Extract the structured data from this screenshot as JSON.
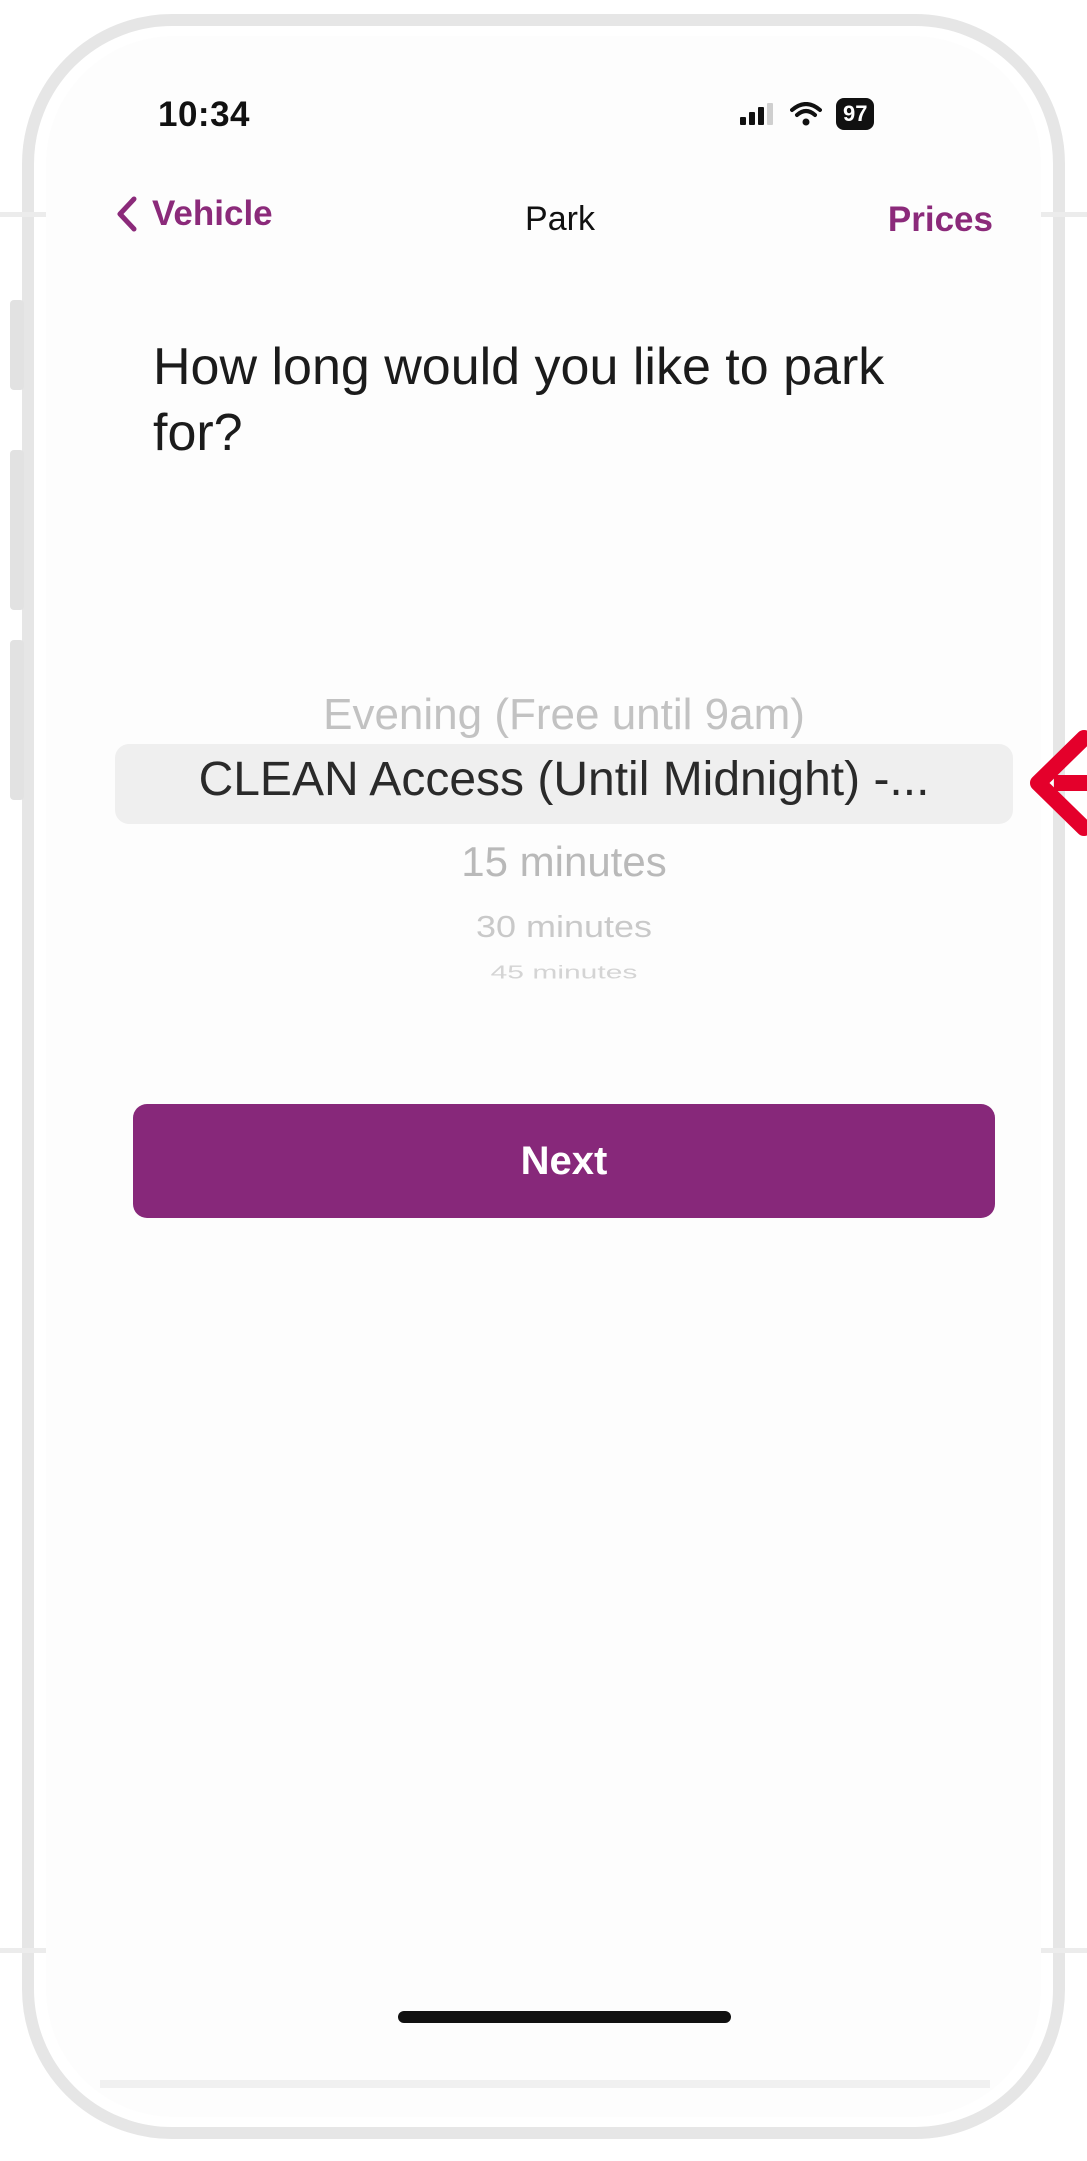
{
  "status_bar": {
    "time": "10:34",
    "battery": "97",
    "signal_icon": "cellular-signal-icon",
    "wifi_icon": "wifi-icon"
  },
  "nav": {
    "back_label": "Vehicle",
    "back_icon": "chevron-left-icon",
    "title": "Park",
    "action_label": "Prices"
  },
  "question": "How long would you like to park for?",
  "picker": {
    "options": [
      "Evening (Free until 9am)",
      "CLEAN Access (Until Midnight) -...",
      "15 minutes",
      "30 minutes",
      "45 minutes"
    ],
    "selected": "CLEAN Access (Until Midnight) -..."
  },
  "next_button": {
    "label": "Next"
  },
  "colors": {
    "accent": "#87287a",
    "annotation_arrow": "#e4002b"
  }
}
